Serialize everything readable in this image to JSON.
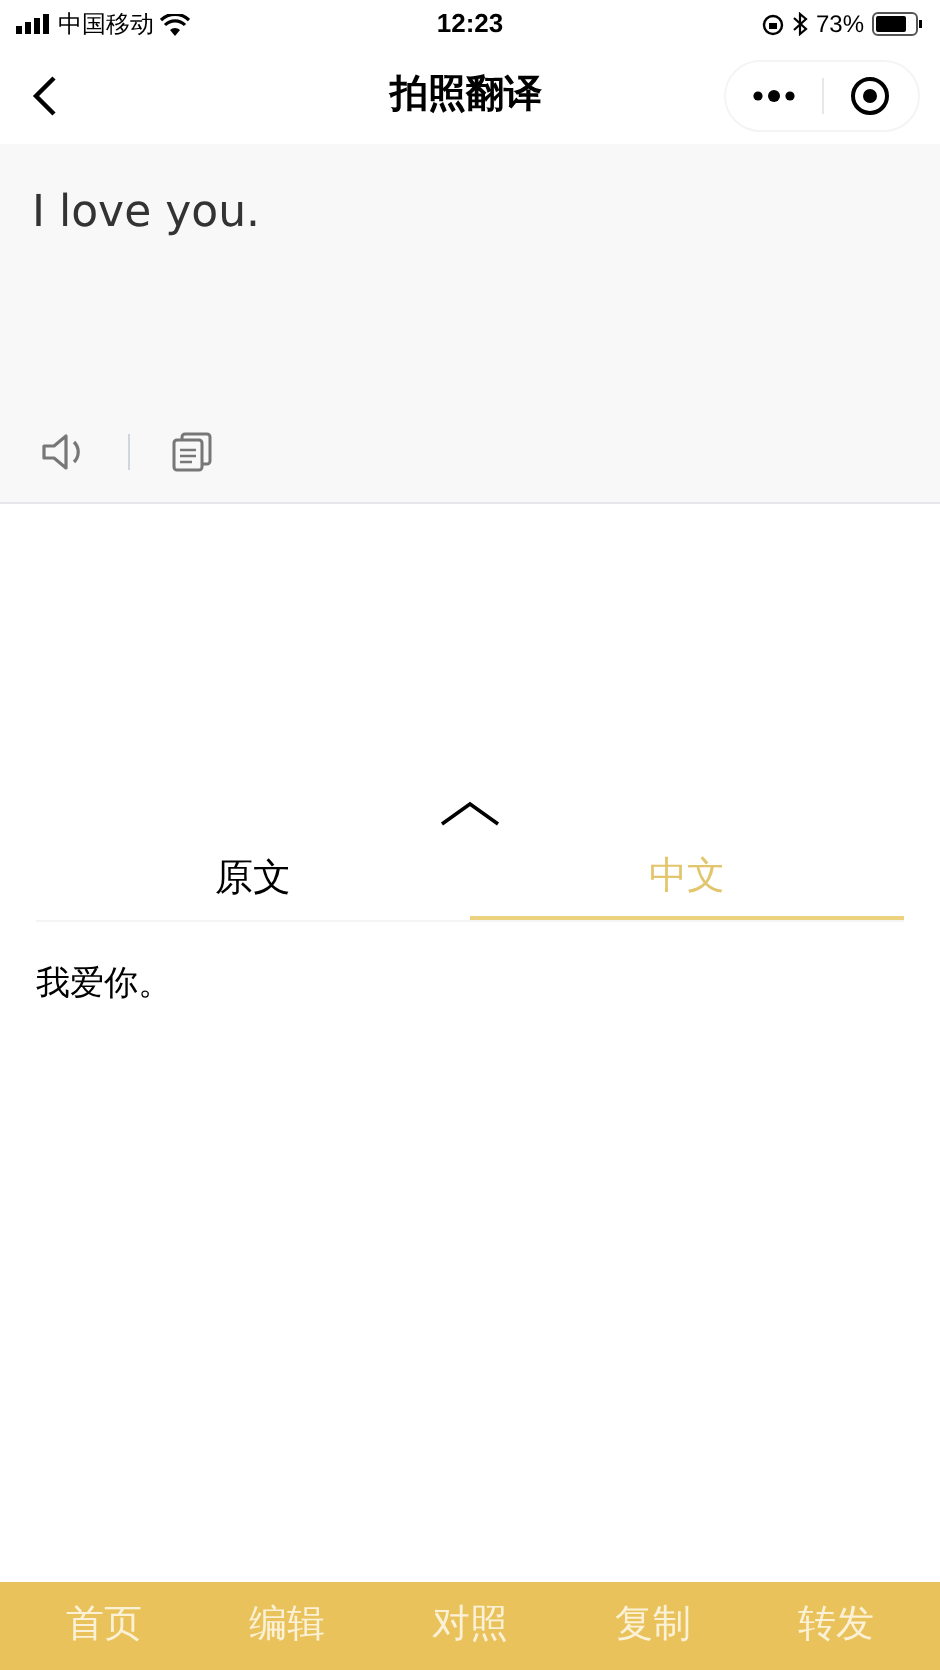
{
  "status_bar": {
    "carrier": "中国移动",
    "time": "12:23",
    "battery": "73%"
  },
  "nav": {
    "title": "拍照翻译"
  },
  "source": {
    "text": "I love you."
  },
  "tabs": [
    {
      "label": "原文",
      "selected": false
    },
    {
      "label": "中文",
      "selected": true
    }
  ],
  "result": {
    "text": "我爱你。"
  },
  "bottom_bar": [
    "首页",
    "编辑",
    "对照",
    "复制",
    "转发"
  ]
}
